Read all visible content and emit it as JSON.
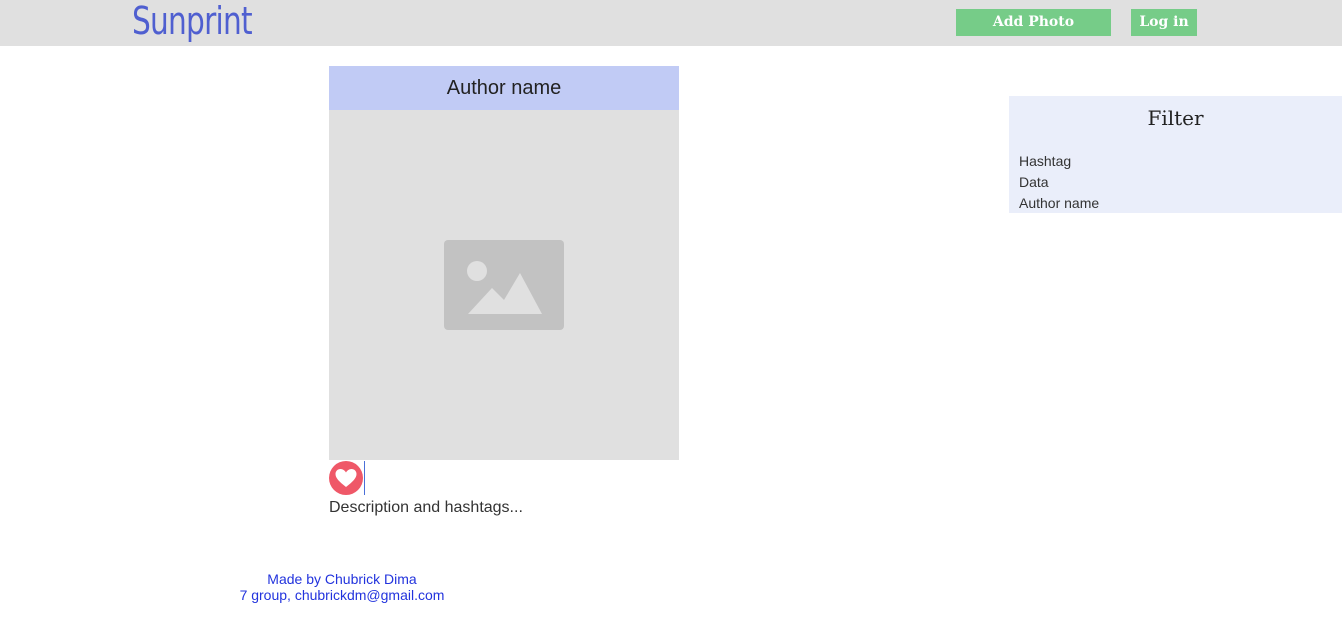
{
  "header": {
    "logo": "Sunprint",
    "add_photo_label": "Add Photo",
    "login_label": "Log in",
    "background_color": "#e0e0e0",
    "logo_color": "#4f5fd0",
    "button_color": "#76cc88"
  },
  "post": {
    "author": "Author name",
    "image_icon": "image-placeholder-icon",
    "like_icon": "heart-icon",
    "like_color": "#ef5868",
    "description": "Description and hashtags..."
  },
  "filter": {
    "title": "Filter",
    "items": [
      {
        "label": "Hashtag"
      },
      {
        "label": "Data"
      },
      {
        "label": "Author name"
      }
    ]
  },
  "footer": {
    "line1": "Made by Chubrick Dima",
    "line2": "7 group, chubrickdm@gmail.com",
    "color": "#2233dd"
  }
}
